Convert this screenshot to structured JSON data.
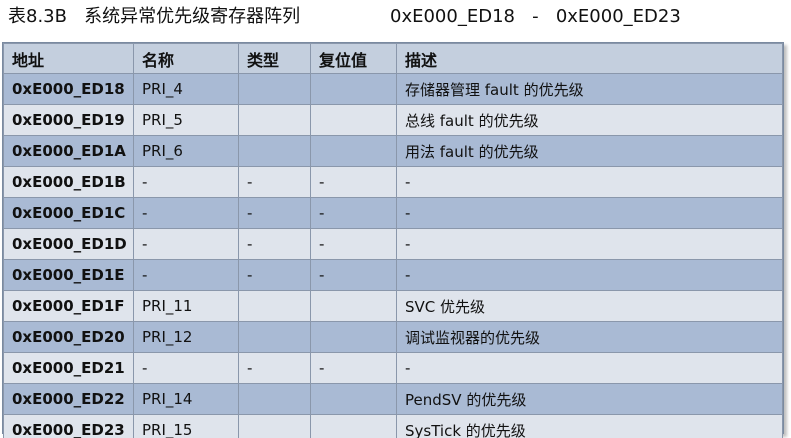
{
  "caption": {
    "table_no": "表8.3B",
    "title": "系统异常优先级寄存器阵列",
    "range_start": "0xE000_ED18",
    "range_sep": "-",
    "range_end": "0xE000_ED23"
  },
  "table": {
    "headers": [
      "地址",
      "名称",
      "类型",
      "复位值",
      "描述"
    ],
    "rows": [
      {
        "addr": "0xE000_ED18",
        "name": "PRI_4",
        "type": "",
        "reset": "",
        "desc": "存储器管理 fault 的优先级"
      },
      {
        "addr": "0xE000_ED19",
        "name": "PRI_5",
        "type": "",
        "reset": "",
        "desc": "总线 fault 的优先级"
      },
      {
        "addr": "0xE000_ED1A",
        "name": "PRI_6",
        "type": "",
        "reset": "",
        "desc": "用法 fault 的优先级"
      },
      {
        "addr": "0xE000_ED1B",
        "name": "-",
        "type": "-",
        "reset": "-",
        "desc": "-"
      },
      {
        "addr": "0xE000_ED1C",
        "name": "-",
        "type": "-",
        "reset": "-",
        "desc": "-"
      },
      {
        "addr": "0xE000_ED1D",
        "name": "-",
        "type": "-",
        "reset": "-",
        "desc": "-"
      },
      {
        "addr": "0xE000_ED1E",
        "name": "-",
        "type": "-",
        "reset": "-",
        "desc": "-"
      },
      {
        "addr": "0xE000_ED1F",
        "name": "PRI_11",
        "type": "",
        "reset": "",
        "desc": "SVC 优先级"
      },
      {
        "addr": "0xE000_ED20",
        "name": "PRI_12",
        "type": "",
        "reset": "",
        "desc": "调试监视器的优先级"
      },
      {
        "addr": "0xE000_ED21",
        "name": "-",
        "type": "-",
        "reset": "-",
        "desc": "-"
      },
      {
        "addr": "0xE000_ED22",
        "name": "PRI_14",
        "type": "",
        "reset": "",
        "desc": "PendSV 的优先级"
      },
      {
        "addr": "0xE000_ED23",
        "name": "PRI_15",
        "type": "",
        "reset": "",
        "desc": "SysTick 的优先级"
      }
    ]
  },
  "colors": {
    "header_bg": "#c4cfde",
    "row_shaded": "#a9bad4",
    "row_plain": "#dfe4ec",
    "border": "#8a97ab"
  }
}
